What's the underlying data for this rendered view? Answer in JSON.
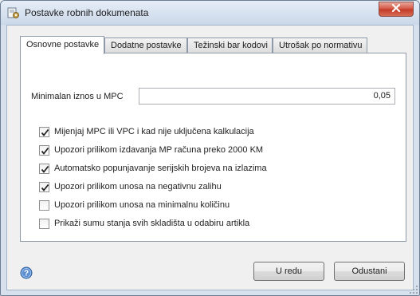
{
  "window": {
    "title": "Postavke robnih dokumenata",
    "app_icon": "settings-document-icon",
    "close_icon": "close-icon"
  },
  "tabs": [
    {
      "label": "Osnovne postavke",
      "active": true
    },
    {
      "label": "Dodatne postavke",
      "active": false
    },
    {
      "label": "Težinski bar kodovi",
      "active": false
    },
    {
      "label": "Utrošak po normativu",
      "active": false
    }
  ],
  "settings": {
    "min_amount_label": "Minimalan iznos u MPC",
    "min_amount_value": "0,05"
  },
  "checkboxes": [
    {
      "label": "Mijenjaj MPC ili VPC i kad nije uključena kalkulacija",
      "checked": true
    },
    {
      "label": "Upozori prilikom izdavanja MP računa preko 2000 KM",
      "checked": true
    },
    {
      "label": "Automatsko popunjavanje serijskih brojeva na izlazima",
      "checked": true
    },
    {
      "label": "Upozori prilikom unosa na negativnu zalihu",
      "checked": true
    },
    {
      "label": "Upozori prilikom unosa na minimalnu količinu",
      "checked": false
    },
    {
      "label": "Prikaži sumu stanja svih skladišta u odabiru artikla",
      "checked": false
    }
  ],
  "footer": {
    "help_icon": "help-icon",
    "ok_label": "U redu",
    "cancel_label": "Odustani"
  }
}
